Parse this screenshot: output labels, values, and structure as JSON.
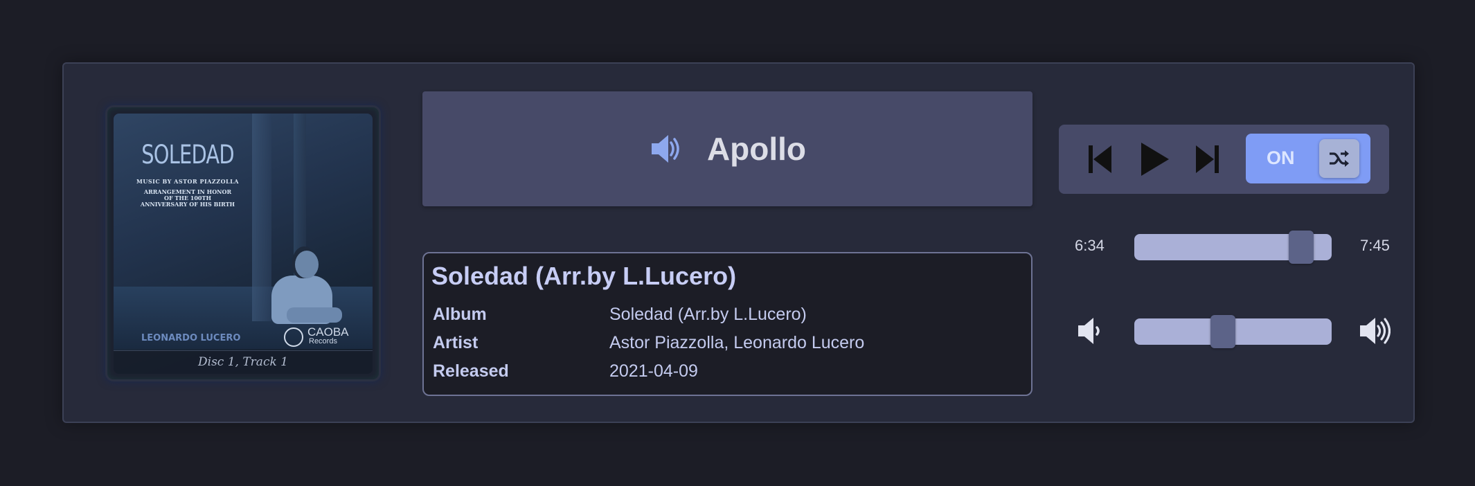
{
  "album_art": {
    "title": "SOLEDAD",
    "music_by": "MUSIC BY ASTOR PIAZZOLLA",
    "arrangement": "ARRANGEMENT IN HONOR OF THE 100TH ANNIVERSARY OF HIS BIRTH",
    "artist_text": "LEONARDO LUCERO",
    "label": "CAOBA",
    "label_sub": "Records",
    "caption": "Disc 1, Track 1"
  },
  "station": {
    "name": "Apollo",
    "icon": "speaker-icon"
  },
  "track": {
    "title": "Soledad (Arr.by L.Lucero)",
    "fields": [
      {
        "key": "Album",
        "value": "Soledad (Arr.by L.Lucero)"
      },
      {
        "key": "Artist",
        "value": "Astor Piazzolla, Leonardo Lucero"
      },
      {
        "key": "Released",
        "value": "2021-04-09"
      }
    ]
  },
  "controls": {
    "previous_icon": "skip-previous-icon",
    "play_icon": "play-icon",
    "next_icon": "skip-next-icon",
    "shuffle_label": "ON",
    "shuffle_icon": "shuffle-icon"
  },
  "progress": {
    "elapsed": "6:34",
    "total": "7:45",
    "fraction": 0.847
  },
  "volume": {
    "low_icon": "volume-low-icon",
    "high_icon": "volume-high-icon",
    "level": 0.45
  },
  "colors": {
    "background": "#1c1d26",
    "panel": "#272a3a",
    "accent": "#7f9cf5",
    "header": "#474a68",
    "slider_track": "#aab0d7",
    "slider_thumb": "#5c6388"
  }
}
